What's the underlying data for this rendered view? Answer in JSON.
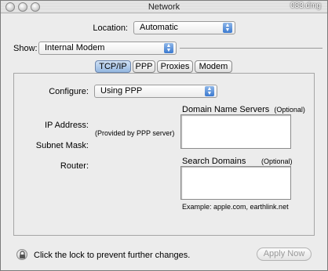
{
  "window": {
    "title": "Network",
    "doc_title": "083.dmg"
  },
  "location": {
    "label": "Location:",
    "value": "Automatic"
  },
  "show": {
    "label": "Show:",
    "value": "Internal Modem"
  },
  "tabs": [
    {
      "label": "TCP/IP",
      "active": true
    },
    {
      "label": "PPP",
      "active": false
    },
    {
      "label": "Proxies",
      "active": false
    },
    {
      "label": "Modem",
      "active": false
    }
  ],
  "tcpip": {
    "configure_label": "Configure:",
    "configure_value": "Using PPP",
    "ip_address_label": "IP Address:",
    "ip_address_value": "(Provided by PPP server)",
    "subnet_mask_label": "Subnet Mask:",
    "router_label": "Router:",
    "dns_label": "Domain Name Servers",
    "dns_optional": "(Optional)",
    "dns_value": "",
    "search_label": "Search Domains",
    "search_optional": "(Optional)",
    "search_value": "",
    "example_text": "Example: apple.com, earthlink.net"
  },
  "footer": {
    "lock_text": "Click the lock to prevent further changes.",
    "apply_label": "Apply Now"
  },
  "icons": {
    "close": "close-icon",
    "minimize": "minimize-icon",
    "zoom": "zoom-icon",
    "lock": "lock-icon",
    "popup_arrows": "chevron-updown-icon"
  }
}
